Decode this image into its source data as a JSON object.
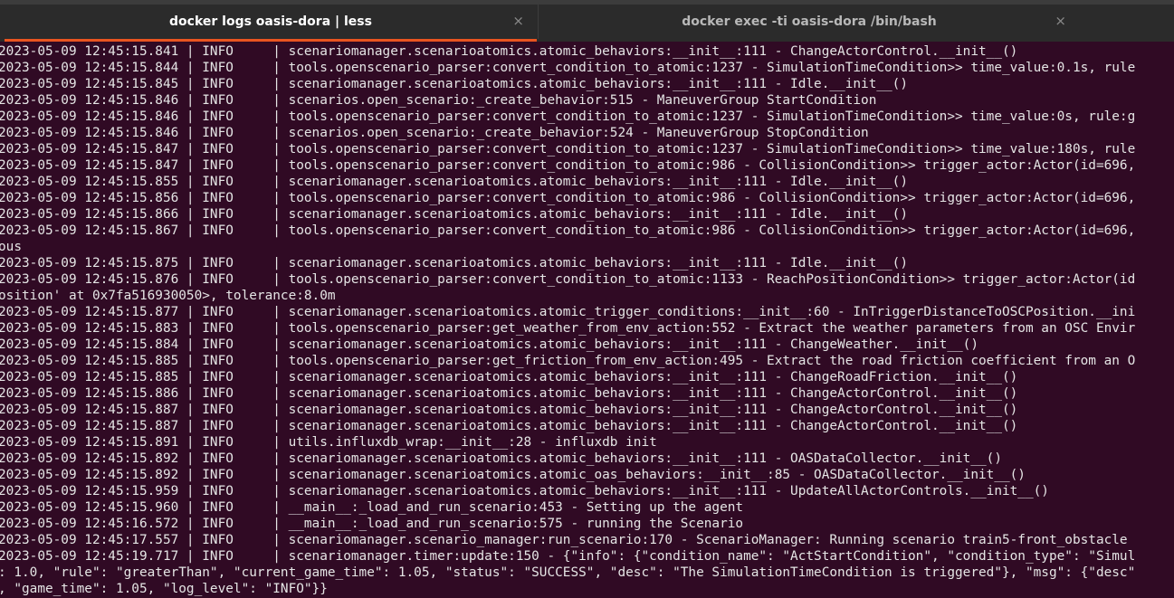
{
  "tabs": [
    {
      "title": "docker logs oasis-dora | less",
      "active": true,
      "close_icon": "×"
    },
    {
      "title": "docker exec -ti oasis-dora /bin/bash",
      "active": false,
      "close_icon": "×"
    }
  ],
  "colors": {
    "terminal_bg": "#300a24",
    "terminal_fg": "#e5e5e5",
    "tab_bar": "#2b2b2b",
    "active_tab_indicator": "#e95420"
  },
  "terminal": {
    "lines": [
      "2023-05-09 12:45:15.841 | INFO     | scenariomanager.scenarioatomics.atomic_behaviors:__init__:111 - ChangeActorControl.__init__()",
      "2023-05-09 12:45:15.844 | INFO     | tools.openscenario_parser:convert_condition_to_atomic:1237 - SimulationTimeCondition>> time_value:0.1s, rule",
      "2023-05-09 12:45:15.845 | INFO     | scenariomanager.scenarioatomics.atomic_behaviors:__init__:111 - Idle.__init__()",
      "2023-05-09 12:45:15.846 | INFO     | scenarios.open_scenario:_create_behavior:515 - ManeuverGroup StartCondition",
      "2023-05-09 12:45:15.846 | INFO     | tools.openscenario_parser:convert_condition_to_atomic:1237 - SimulationTimeCondition>> time_value:0s, rule:g",
      "2023-05-09 12:45:15.846 | INFO     | scenarios.open_scenario:_create_behavior:524 - ManeuverGroup StopCondition",
      "2023-05-09 12:45:15.847 | INFO     | tools.openscenario_parser:convert_condition_to_atomic:1237 - SimulationTimeCondition>> time_value:180s, rule",
      "2023-05-09 12:45:15.847 | INFO     | tools.openscenario_parser:convert_condition_to_atomic:986 - CollisionCondition>> trigger_actor:Actor(id=696,",
      "2023-05-09 12:45:15.855 | INFO     | scenariomanager.scenarioatomics.atomic_behaviors:__init__:111 - Idle.__init__()",
      "2023-05-09 12:45:15.856 | INFO     | tools.openscenario_parser:convert_condition_to_atomic:986 - CollisionCondition>> trigger_actor:Actor(id=696,",
      "2023-05-09 12:45:15.866 | INFO     | scenariomanager.scenarioatomics.atomic_behaviors:__init__:111 - Idle.__init__()",
      "2023-05-09 12:45:15.867 | INFO     | tools.openscenario_parser:convert_condition_to_atomic:986 - CollisionCondition>> trigger_actor:Actor(id=696,",
      "ous",
      "2023-05-09 12:45:15.875 | INFO     | scenariomanager.scenarioatomics.atomic_behaviors:__init__:111 - Idle.__init__()",
      "2023-05-09 12:45:15.876 | INFO     | tools.openscenario_parser:convert_condition_to_atomic:1133 - ReachPositionCondition>> trigger_actor:Actor(id",
      "osition' at 0x7fa516930050>, tolerance:8.0m",
      "2023-05-09 12:45:15.877 | INFO     | scenariomanager.scenarioatomics.atomic_trigger_conditions:__init__:60 - InTriggerDistanceToOSCPosition.__ini",
      "2023-05-09 12:45:15.883 | INFO     | tools.openscenario_parser:get_weather_from_env_action:552 - Extract the weather parameters from an OSC Envir",
      "2023-05-09 12:45:15.884 | INFO     | scenariomanager.scenarioatomics.atomic_behaviors:__init__:111 - ChangeWeather.__init__()",
      "2023-05-09 12:45:15.885 | INFO     | tools.openscenario_parser:get_friction_from_env_action:495 - Extract the road friction coefficient from an O",
      "2023-05-09 12:45:15.885 | INFO     | scenariomanager.scenarioatomics.atomic_behaviors:__init__:111 - ChangeRoadFriction.__init__()",
      "2023-05-09 12:45:15.886 | INFO     | scenariomanager.scenarioatomics.atomic_behaviors:__init__:111 - ChangeActorControl.__init__()",
      "2023-05-09 12:45:15.887 | INFO     | scenariomanager.scenarioatomics.atomic_behaviors:__init__:111 - ChangeActorControl.__init__()",
      "2023-05-09 12:45:15.887 | INFO     | scenariomanager.scenarioatomics.atomic_behaviors:__init__:111 - ChangeActorControl.__init__()",
      "2023-05-09 12:45:15.891 | INFO     | utils.influxdb_wrap:__init__:28 - influxdb init",
      "2023-05-09 12:45:15.892 | INFO     | scenariomanager.scenarioatomics.atomic_behaviors:__init__:111 - OASDataCollector.__init__()",
      "2023-05-09 12:45:15.892 | INFO     | scenariomanager.scenarioatomics.atomic_oas_behaviors:__init__:85 - OASDataCollector.__init__()",
      "2023-05-09 12:45:15.959 | INFO     | scenariomanager.scenarioatomics.atomic_behaviors:__init__:111 - UpdateAllActorControls.__init__()",
      "2023-05-09 12:45:15.960 | INFO     | __main__:_load_and_run_scenario:453 - Setting up the agent",
      "2023-05-09 12:45:16.572 | INFO     | __main__:_load_and_run_scenario:575 - running the Scenario",
      "2023-05-09 12:45:17.557 | INFO     | scenariomanager.scenario_manager:run_scenario:170 - ScenarioManager: Running scenario train5-front_obstacle",
      "2023-05-09 12:45:19.717 | INFO     | scenariomanager.timer:update:150 - {\"info\": {\"condition_name\": \"ActStartCondition\", \"condition_type\": \"Simul",
      ": 1.0, \"rule\": \"greaterThan\", \"current_game_time\": 1.05, \"status\": \"SUCCESS\", \"desc\": \"The SimulationTimeCondition is triggered\"}, \"msg\": {\"desc\"",
      ", \"game_time\": 1.05, \"log_level\": \"INFO\"}}"
    ]
  }
}
